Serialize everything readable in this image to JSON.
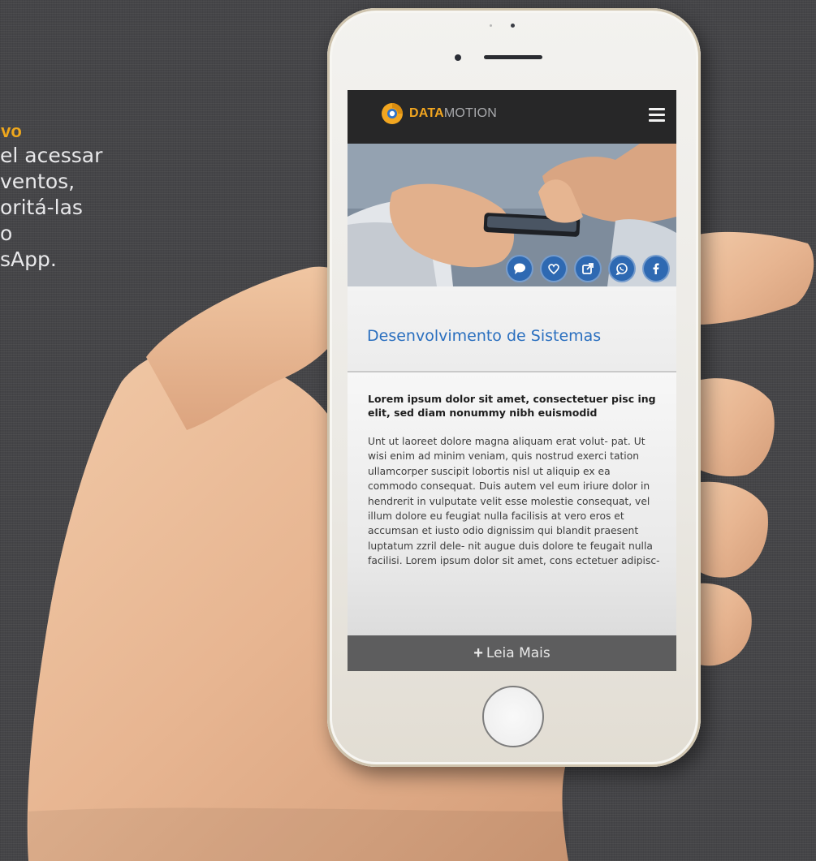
{
  "promo": {
    "title": "ivo",
    "lines": [
      "el acessar",
      "ventos,",
      "oritá-las",
      "o",
      "sApp."
    ]
  },
  "app": {
    "brand_part1": "DATA",
    "brand_part2": "MOTION",
    "colors": {
      "accent": "#f2a620",
      "link": "#2a6fbf",
      "share": "#2e69b2",
      "topbar": "#272728"
    }
  },
  "share_buttons": [
    "comment-icon",
    "heart-icon",
    "external-link-icon",
    "whatsapp-icon",
    "facebook-icon"
  ],
  "article": {
    "title": "Desenvolvimento de Sistemas",
    "lead": "Lorem ipsum dolor sit amet, consectetuer pisc ing elit, sed diam nonummy nibh euismodid",
    "body": "Unt ut laoreet dolore magna aliquam erat volut- pat. Ut wisi enim ad minim veniam, quis nostrud exerci tation ullamcorper suscipit lobortis nisl ut aliquip ex ea commodo consequat. Duis autem vel eum iriure dolor in hendrerit in vulputate velit esse molestie consequat, vel illum dolore eu feugiat nulla facilisis at vero eros et accumsan et iusto odio dignissim qui blandit praesent luptatum zzril dele- nit augue duis dolore te feugait nulla facilisi. Lorem ipsum dolor sit amet, cons ectetuer adipisc-",
    "more_label": "Leia Mais"
  }
}
